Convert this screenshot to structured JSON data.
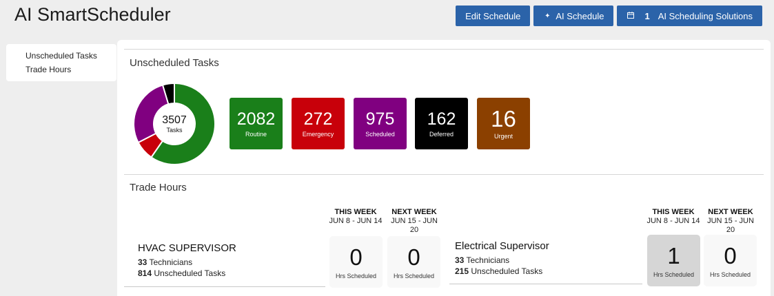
{
  "app": {
    "title": "AI SmartScheduler"
  },
  "toolbar": {
    "edit_label": "Edit Schedule",
    "ai_label": "AI Schedule",
    "solutions_count": "1",
    "solutions_label": "AI Scheduling Solutions",
    "accent": "#2b63a9"
  },
  "sidebar": {
    "items": [
      {
        "label": "Unscheduled Tasks"
      },
      {
        "label": "Trade Hours"
      }
    ]
  },
  "unscheduled": {
    "title": "Unscheduled Tasks",
    "total": "3507",
    "total_label": "Tasks",
    "tiles": [
      {
        "value": "2082",
        "label": "Routine",
        "color": "#1a7f1a"
      },
      {
        "value": "272",
        "label": "Emergency",
        "color": "#c8000a"
      },
      {
        "value": "975",
        "label": "Scheduled",
        "color": "#800080"
      },
      {
        "value": "162",
        "label": "Deferred",
        "color": "#000000"
      },
      {
        "value": "16",
        "label": "Urgent",
        "color": "#8b4000"
      }
    ]
  },
  "chart_data": {
    "type": "pie",
    "categories": [
      "Routine",
      "Emergency",
      "Scheduled",
      "Deferred",
      "Urgent"
    ],
    "values": [
      2082,
      272,
      975,
      162,
      16
    ],
    "colors": [
      "#1a7f1a",
      "#c8000a",
      "#800080",
      "#000000",
      "#8b4000"
    ],
    "title": ""
  },
  "trade_hours": {
    "title": "Trade Hours",
    "weeks": [
      {
        "title": "THIS WEEK",
        "range": "JUN 8 - JUN 14"
      },
      {
        "title": "NEXT WEEK",
        "range": "JUN 15 - JUN 20"
      }
    ],
    "supervisors": [
      {
        "name": "HVAC SUPERVISOR",
        "technicians": "33",
        "technicians_label": "Technicians",
        "unscheduled": "814",
        "unscheduled_label": "Unscheduled Tasks",
        "this_week": "0",
        "next_week": "0",
        "hours_label": "Hrs Scheduled"
      },
      {
        "name": "Electrical Supervisor",
        "technicians": "33",
        "technicians_label": "Technicians",
        "unscheduled": "215",
        "unscheduled_label": "Unscheduled Tasks",
        "this_week": "1",
        "next_week": "0",
        "hours_label": "Hrs Scheduled"
      }
    ]
  }
}
